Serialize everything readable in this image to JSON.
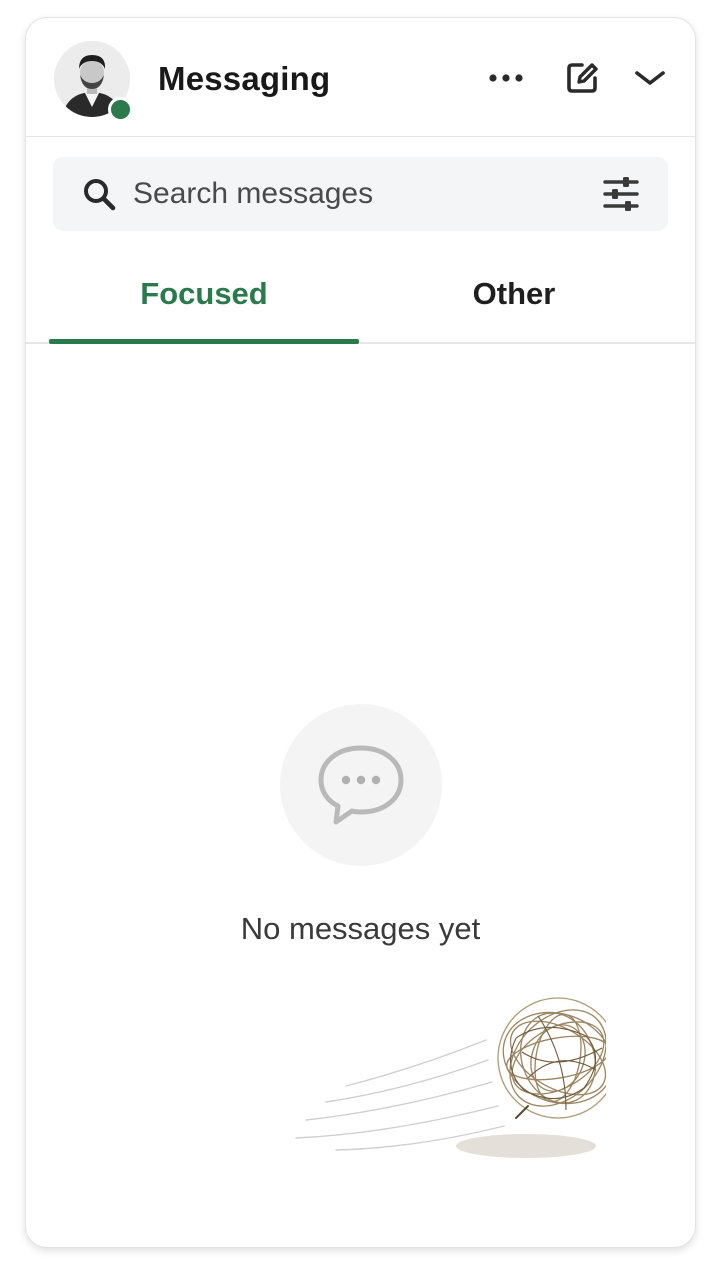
{
  "header": {
    "title": "Messaging",
    "avatar_alt": "profile photo",
    "presence": "online",
    "icons": [
      "more-options-icon",
      "compose-icon",
      "chevron-down-icon"
    ]
  },
  "search": {
    "placeholder": "Search messages",
    "value": "",
    "filter_icon": "filter-sliders-icon"
  },
  "tabs": [
    {
      "label": "Focused",
      "active": true
    },
    {
      "label": "Other",
      "active": false
    }
  ],
  "empty_state": {
    "icon": "chat-bubble-icon",
    "message": "No messages yet",
    "illustration": "tumbleweed"
  },
  "colors": {
    "accent": "#2b7a4b",
    "text_primary": "#191919",
    "search_bg": "#f3f5f7",
    "divider": "#e6e6e6"
  }
}
